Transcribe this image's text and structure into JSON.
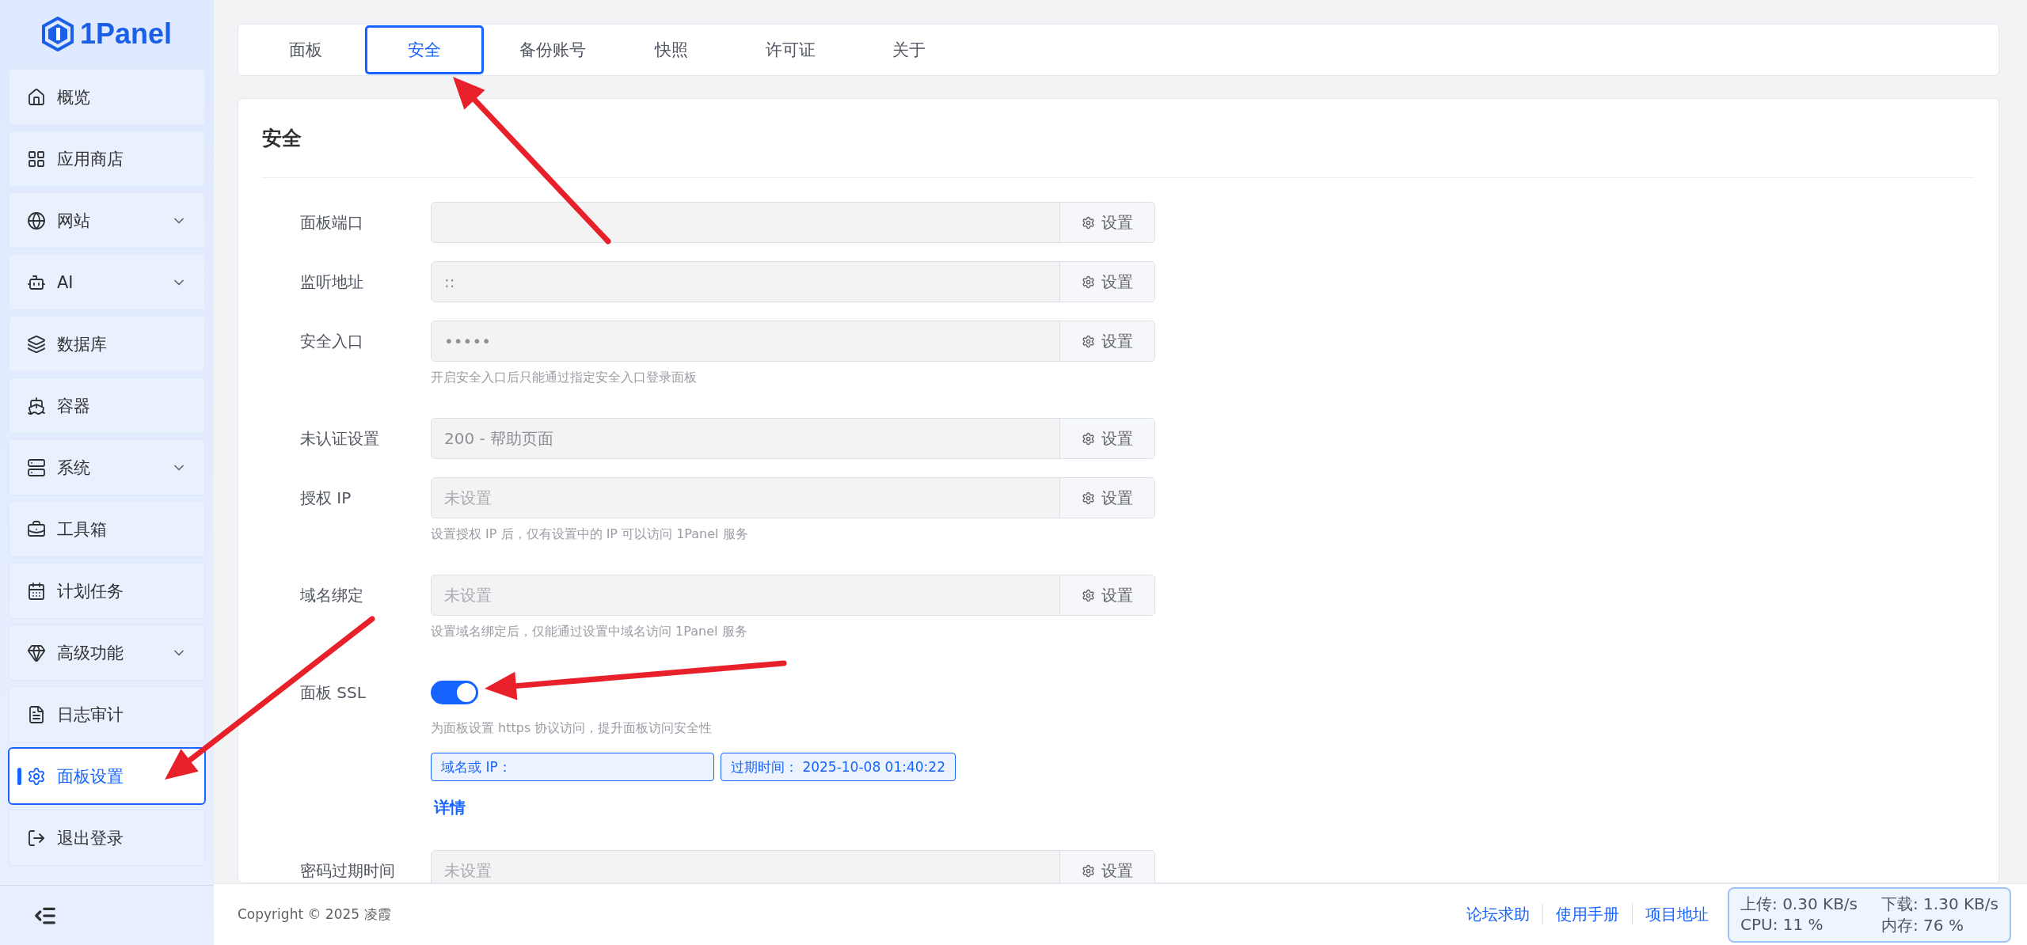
{
  "logo": {
    "text": "1Panel"
  },
  "sidebar": {
    "items": [
      {
        "label": "概览",
        "kind": "link",
        "selected": false
      },
      {
        "label": "应用商店",
        "kind": "link",
        "selected": false
      },
      {
        "label": "网站",
        "kind": "group",
        "selected": false
      },
      {
        "label": "AI",
        "kind": "group",
        "selected": false
      },
      {
        "label": "数据库",
        "kind": "link",
        "selected": false
      },
      {
        "label": "容器",
        "kind": "link",
        "selected": false
      },
      {
        "label": "系统",
        "kind": "group",
        "selected": false
      },
      {
        "label": "工具箱",
        "kind": "link",
        "selected": false
      },
      {
        "label": "计划任务",
        "kind": "link",
        "selected": false
      },
      {
        "label": "高级功能",
        "kind": "group",
        "selected": false
      },
      {
        "label": "日志审计",
        "kind": "link",
        "selected": false
      },
      {
        "label": "面板设置",
        "kind": "link",
        "selected": true
      },
      {
        "label": "退出登录",
        "kind": "link",
        "selected": false
      }
    ]
  },
  "tabs": [
    {
      "label": "面板",
      "selected": false
    },
    {
      "label": "安全",
      "selected": true
    },
    {
      "label": "备份账号",
      "selected": false
    },
    {
      "label": "快照",
      "selected": false
    },
    {
      "label": "许可证",
      "selected": false
    },
    {
      "label": "关于",
      "selected": false
    }
  ],
  "section": {
    "title": "安全"
  },
  "fields": [
    {
      "kind": "input",
      "label": "面板端口",
      "button": "设置"
    },
    {
      "kind": "input",
      "label": "监听地址",
      "value": "::",
      "button": "设置"
    },
    {
      "kind": "input",
      "label": "安全入口",
      "value": "•••••",
      "button": "设置",
      "hint": "开启安全入口后只能通过指定安全入口登录面板"
    },
    {
      "kind": "input",
      "label": "未认证设置",
      "value": "200 - 帮助页面",
      "button": "设置"
    },
    {
      "kind": "input",
      "label": "授权 IP",
      "placeholder": "未设置",
      "button": "设置",
      "hint": "设置授权 IP 后，仅有设置中的 IP 可以访问 1Panel 服务"
    },
    {
      "kind": "input",
      "label": "域名绑定",
      "placeholder": "未设置",
      "button": "设置",
      "hint": "设置域名绑定后，仅能通过设置中域名访问 1Panel 服务"
    },
    {
      "kind": "switch",
      "label": "面板 SSL",
      "on": true,
      "hint": "为面板设置 https 协议访问，提升面板访问安全性",
      "tags": [
        "域名或 IP：",
        "过期时间： 2025-10-08 01:40:22"
      ],
      "link": "详情"
    },
    {
      "kind": "input",
      "label": "密码过期时间",
      "placeholder": "未设置",
      "button": "设置"
    }
  ],
  "footer": {
    "copyright": "Copyright © 2025 凌霞",
    "links": [
      "论坛求助",
      "使用手册",
      "项目地址"
    ]
  },
  "monitor": {
    "upload": "上传: 0.30 KB/s",
    "download": "下载: 1.30 KB/s",
    "cpu": "CPU: 11 %",
    "memory": "内存: 76 %"
  }
}
